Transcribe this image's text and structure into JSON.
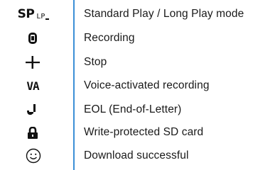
{
  "legend": {
    "items": [
      {
        "icon": "sp-lp-mode-icon",
        "icon_text_primary": "SP",
        "icon_text_secondary": "LP",
        "label": "Standard Play / Long Play mode"
      },
      {
        "icon": "recording-icon",
        "label": "Recording"
      },
      {
        "icon": "stop-icon",
        "label": "Stop"
      },
      {
        "icon": "voice-activated-icon",
        "icon_text": "VA",
        "label": "Voice-activated recording"
      },
      {
        "icon": "eol-icon",
        "label": "EOL (End-of-Letter)"
      },
      {
        "icon": "lock-icon",
        "label": "Write-protected SD card"
      },
      {
        "icon": "smiley-icon",
        "label": "Download successful"
      }
    ]
  },
  "colors": {
    "divider": "#3c8fd6",
    "text": "#1a1a1a",
    "icon": "#111111"
  }
}
